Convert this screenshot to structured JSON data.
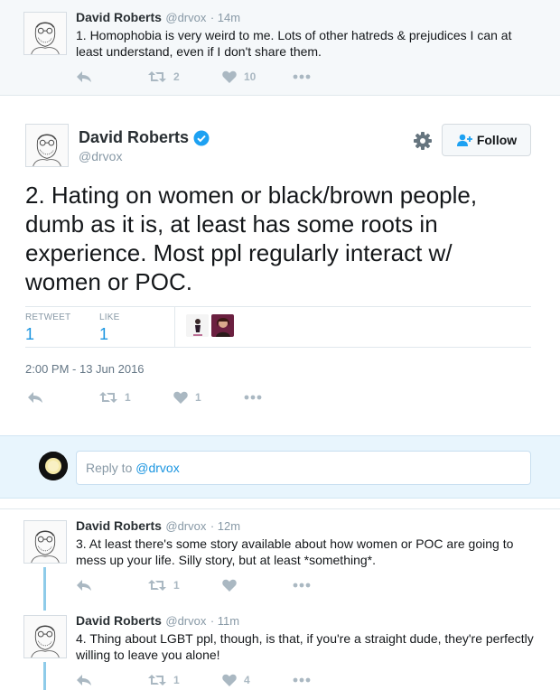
{
  "colors": {
    "link": "#1b95e0",
    "verified": "#1da1f2",
    "thread": "#8ecbe9"
  },
  "ancestor": {
    "name": "David Roberts",
    "handle": "@drvox",
    "time": "· 14m",
    "text": "1. Homophobia is very weird to me. Lots of other hatreds & prejudices I can at least understand, even if I don't share them.",
    "retweets": "2",
    "likes": "10"
  },
  "permalink": {
    "name": "David Roberts",
    "handle": "@drvox",
    "follow_label": "Follow",
    "text": "2. Hating on women or black/brown people, dumb as it is, at least has some roots in experience. Most ppl regularly interact w/ women or POC.",
    "retweet_label": "RETWEET",
    "retweet_count": "1",
    "like_label": "LIKE",
    "like_count": "1",
    "timestamp": "2:00 PM - 13 Jun 2016",
    "action_retweets": "1",
    "action_likes": "1"
  },
  "reply_box": {
    "prefix": "Reply to ",
    "mention": "@drvox"
  },
  "replies": [
    {
      "name": "David Roberts",
      "handle": "@drvox",
      "time": "· 12m",
      "text": "3. At least there's some story available about how women or POC are going to mess up your life. Silly story, but at least *something*.",
      "retweets": "1",
      "likes": ""
    },
    {
      "name": "David Roberts",
      "handle": "@drvox",
      "time": "· 11m",
      "text": "4. Thing about LGBT ppl, though, is that, if you're a straight dude, they're perfectly willing to leave you alone!",
      "retweets": "1",
      "likes": "4"
    }
  ]
}
